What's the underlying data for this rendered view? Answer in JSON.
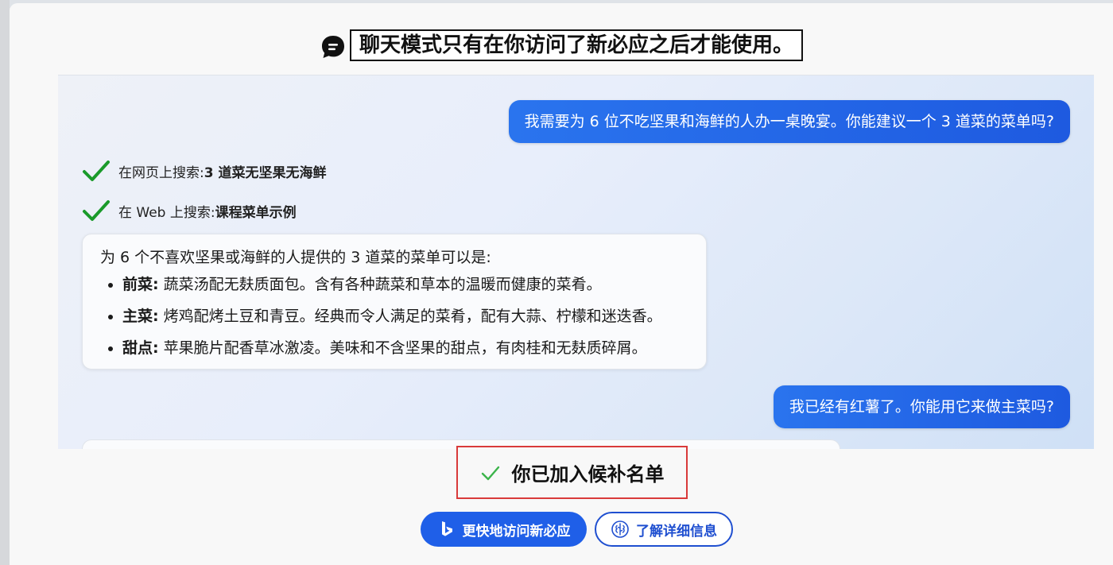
{
  "modal": {
    "title": "聊天模式只有在你访问了新必应之后才能使用。",
    "title_icon": "chat-bubble-icon"
  },
  "chat": {
    "user_message_1": "我需要为 6 位不吃坚果和海鲜的人办一桌晚宴。你能建议一个 3 道菜的菜单吗?",
    "searches": [
      {
        "prefix": "在网页上搜索: ",
        "query": "3 道菜无坚果无海鲜"
      },
      {
        "prefix": "在 Web 上搜索: ",
        "query": "课程菜单示例"
      }
    ],
    "answer": {
      "intro": "为 6 个不喜欢坚果或海鲜的人提供的 3 道菜的菜单可以是:",
      "items": [
        {
          "label": "前菜:",
          "text": " 蔬菜汤配无麸质面包。含有各种蔬菜和草本的温暖而健康的菜肴。"
        },
        {
          "label": "主菜:",
          "text": " 烤鸡配烤土豆和青豆。经典而令人满足的菜肴，配有大蒜、柠檬和迷迭香。"
        },
        {
          "label": "甜点:",
          "text": " 苹果脆片配香草冰激凌。美味和不含坚果的甜点，有肉桂和无麸质碎屑。"
        }
      ]
    },
    "user_message_2": "我已经有红薯了。你能用它来做主菜吗?"
  },
  "waitlist": {
    "text": "你已加入候补名单",
    "icon": "check-icon"
  },
  "buttons": {
    "primary_label": "更快地访问新必应",
    "primary_icon": "bing-logo-icon",
    "secondary_label": "了解详细信息",
    "secondary_icon": "brain-icon"
  },
  "colors": {
    "accent_blue": "#1f5fe8",
    "check_green": "#1a9a2a",
    "highlight_red": "#d93a3a"
  }
}
